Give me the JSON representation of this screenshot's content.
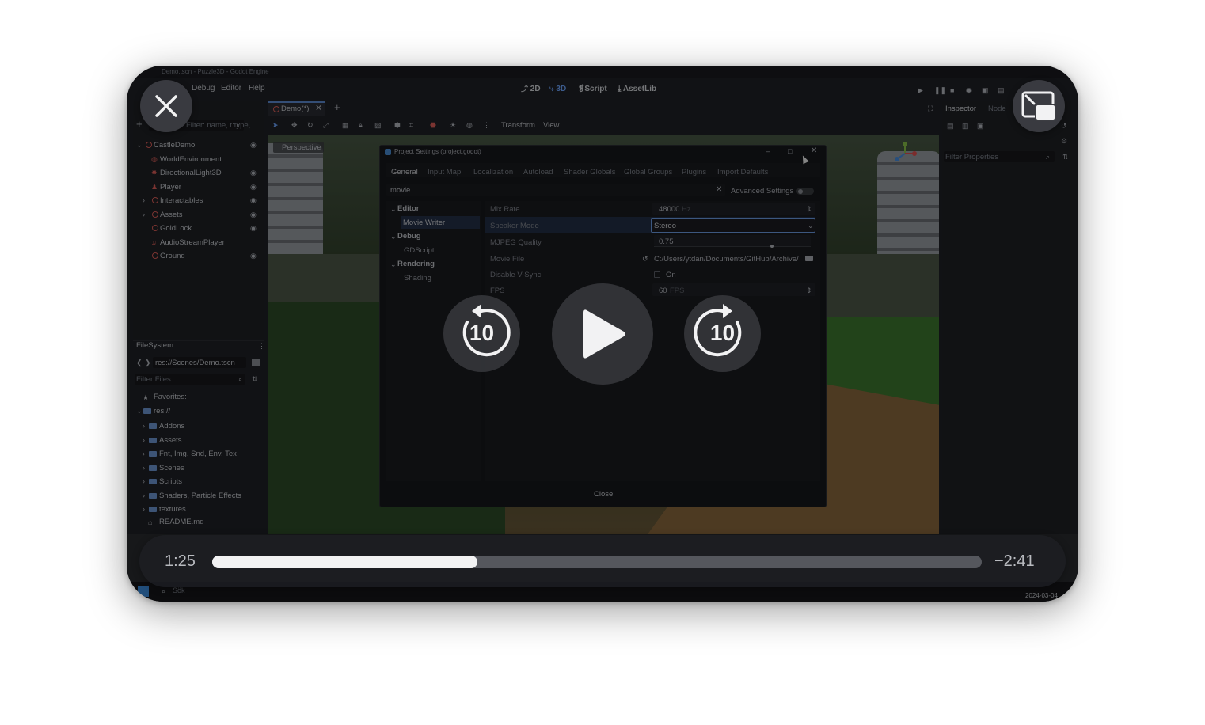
{
  "window_title": "Demo.tscn - Puzzle3D - Godot Engine",
  "menu": {
    "debug": "Debug",
    "editor": "Editor",
    "help": "Help"
  },
  "workspaces": {
    "two_d": "2D",
    "three_d": "3D",
    "script": "Script",
    "assetlib": "AssetLib"
  },
  "scene_panel": {
    "filter_placeholder": "Filter: name, t:type,",
    "tree": [
      {
        "label": "CastleDemo",
        "icon": "node3d-icon"
      },
      {
        "label": "WorldEnvironment",
        "icon": "globe-icon"
      },
      {
        "label": "DirectionalLight3D",
        "icon": "light-icon"
      },
      {
        "label": "Player",
        "icon": "character-icon"
      },
      {
        "label": "Interactables",
        "icon": "node3d-icon"
      },
      {
        "label": "Assets",
        "icon": "node3d-icon"
      },
      {
        "label": "GoldLock",
        "icon": "node3d-icon"
      },
      {
        "label": "AudioStreamPlayer",
        "icon": "audio-icon"
      },
      {
        "label": "Ground",
        "icon": "node3d-icon"
      }
    ]
  },
  "filesystem": {
    "title": "FileSystem",
    "path": "res://Scenes/Demo.tscn",
    "filter_placeholder": "Filter Files",
    "favorites": "Favorites:",
    "root": "res://",
    "folders": [
      "Addons",
      "Assets",
      "Fnt, Img, Snd, Env, Tex",
      "Scenes",
      "Scripts",
      "Shaders, Particle Effects",
      "textures"
    ],
    "readme": "README.md"
  },
  "scene_tab": "Demo(*)",
  "viewport_toolbar": {
    "transform": "Transform",
    "view": "View",
    "perspective": "Perspective"
  },
  "inspector": {
    "tab_inspector": "Inspector",
    "tab_node": "Node",
    "filter_placeholder": "Filter Properties"
  },
  "dialog": {
    "title": "Project Settings (project.godot)",
    "tabs": [
      "General",
      "Input Map",
      "Localization",
      "Autoload",
      "Shader Globals",
      "Global Groups",
      "Plugins",
      "Import Defaults"
    ],
    "search_value": "movie",
    "advanced_label": "Advanced Settings",
    "sections": [
      {
        "label": "Editor",
        "child": "Movie Writer"
      },
      {
        "label": "Debug",
        "child": "GDScript"
      },
      {
        "label": "Rendering",
        "child": "Shading"
      }
    ],
    "properties": {
      "mix_rate_label": "Mix Rate",
      "mix_rate_value": "48000",
      "mix_rate_unit": "Hz",
      "speaker_mode_label": "Speaker Mode",
      "speaker_mode_value": "Stereo",
      "mjpeg_label": "MJPEG Quality",
      "mjpeg_value": "0.75",
      "movie_file_label": "Movie File",
      "movie_file_value": "C:/Users/ytdan/Documents/GitHub/Archive/",
      "vsync_label": "Disable V-Sync",
      "vsync_value": "On",
      "fps_label": "FPS",
      "fps_value": "60",
      "fps_unit": "FPS"
    },
    "close_label": "Close"
  },
  "taskbar": {
    "search": "Sök",
    "date": "2024-03-04"
  },
  "video_player": {
    "elapsed": "1:25",
    "remaining": "−2:41",
    "progress_fraction": 0.345,
    "skip_back_seconds": "10",
    "skip_forward_seconds": "10"
  }
}
